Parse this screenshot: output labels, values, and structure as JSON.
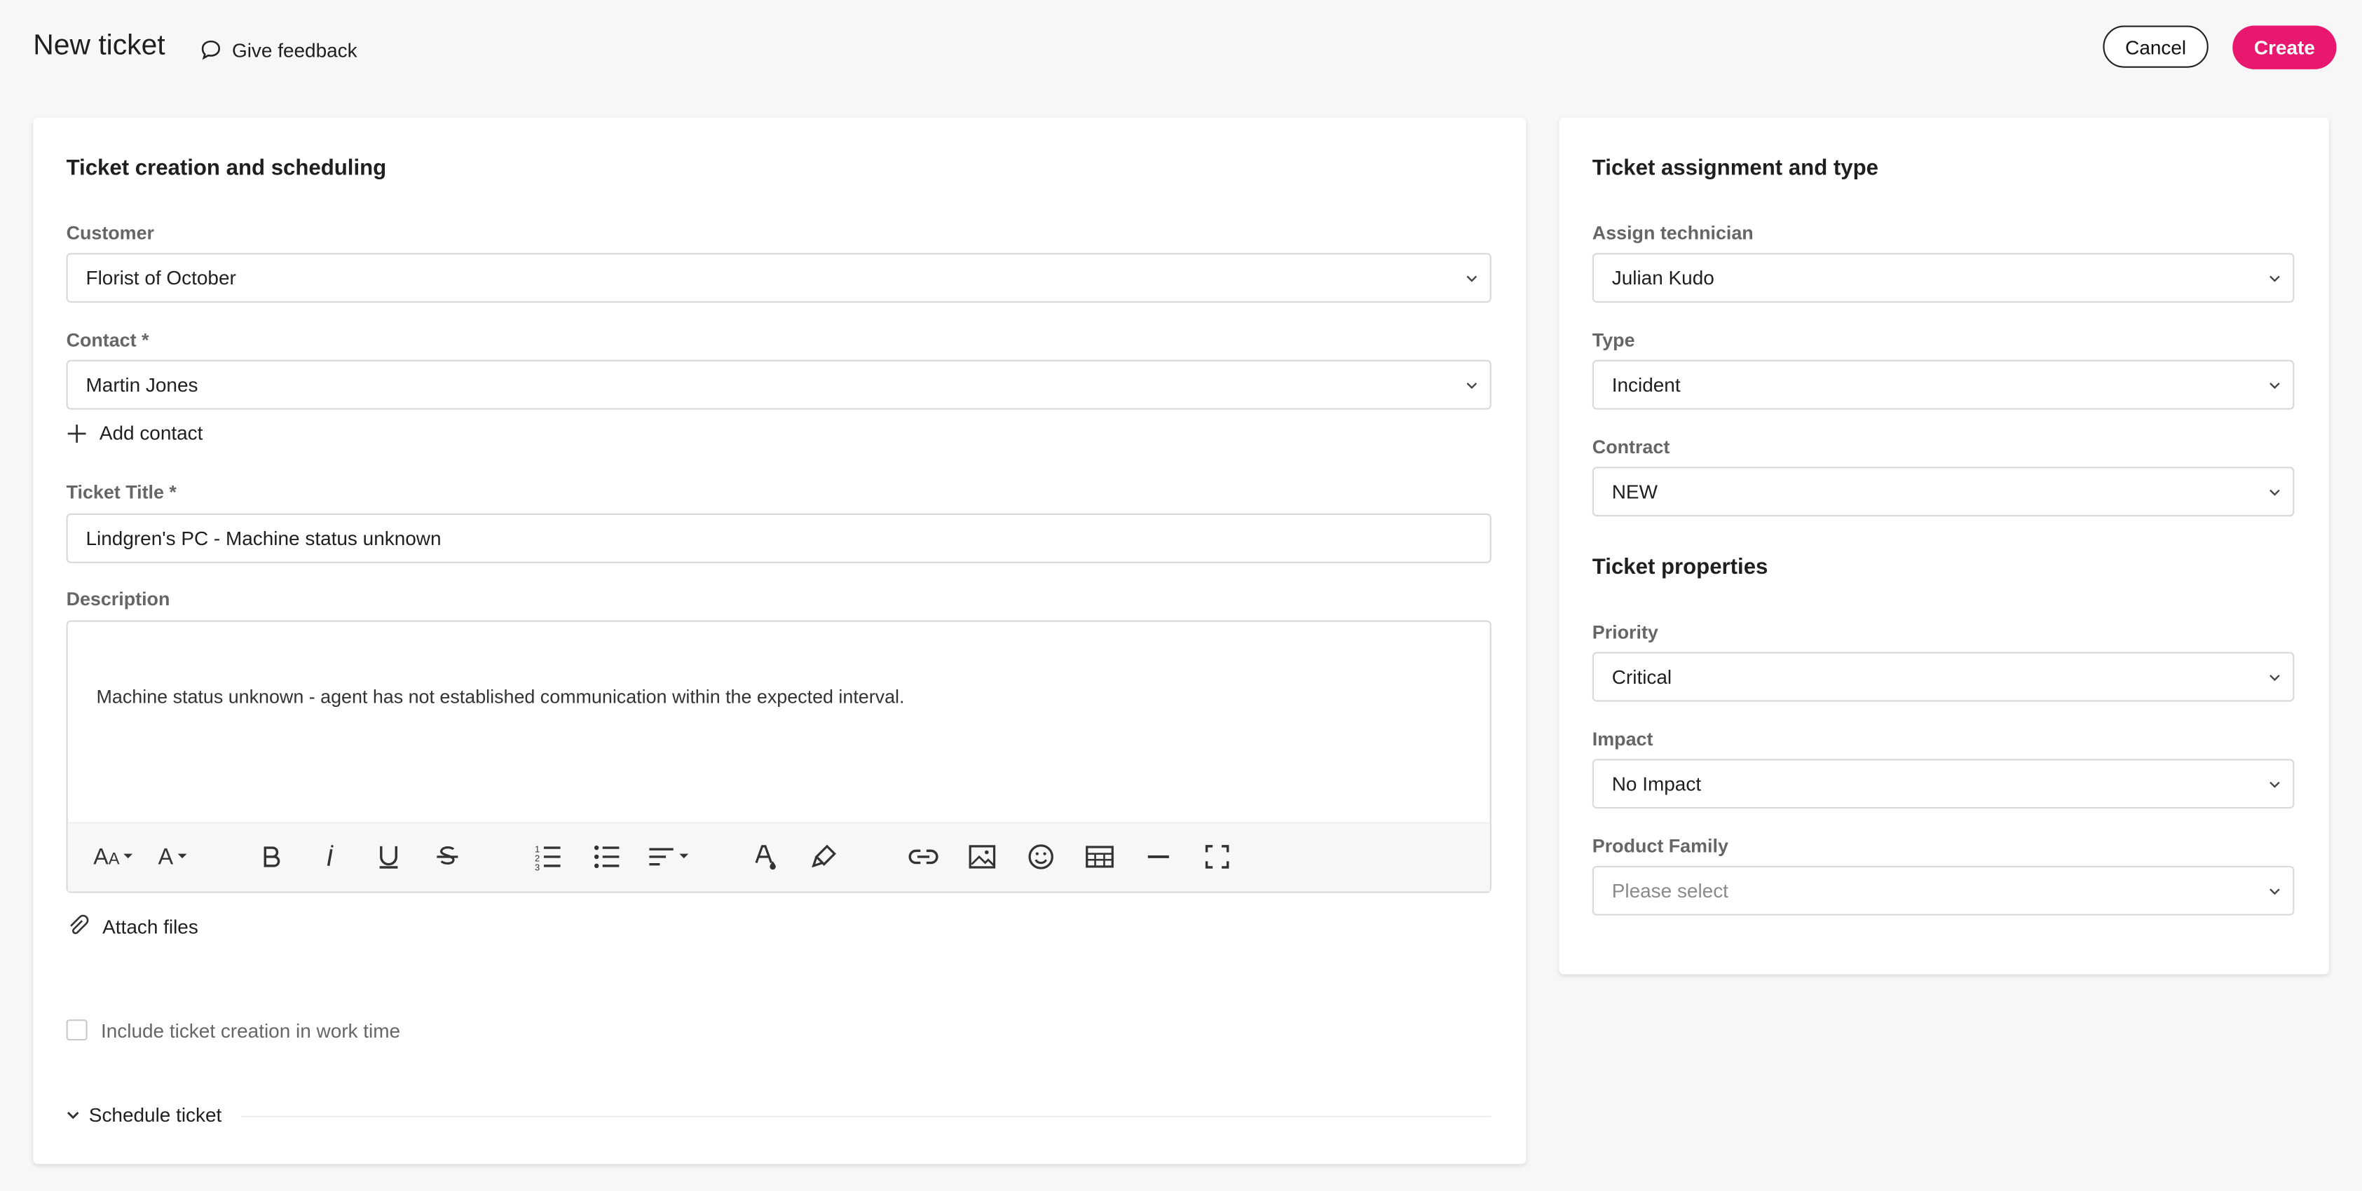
{
  "header": {
    "title": "New ticket",
    "feedback_label": "Give feedback",
    "cancel_label": "Cancel",
    "create_label": "Create"
  },
  "left_card": {
    "title": "Ticket creation and scheduling",
    "customer": {
      "label": "Customer",
      "value": "Florist of October"
    },
    "contact": {
      "label": "Contact *",
      "value": "Martin Jones"
    },
    "add_contact_label": "Add contact",
    "ticket_title": {
      "label": "Ticket Title *",
      "value": "Lindgren's PC - Machine status unknown"
    },
    "description": {
      "label": "Description",
      "text": "Machine status unknown - agent has not established communication within the expected interval."
    },
    "attach_files_label": "Attach files",
    "include_work_time_label": "Include ticket creation in work time",
    "schedule_label": "Schedule ticket"
  },
  "right_card": {
    "title": "Ticket assignment and type",
    "technician": {
      "label": "Assign technician",
      "value": "Julian Kudo"
    },
    "type": {
      "label": "Type",
      "value": "Incident"
    },
    "contract": {
      "label": "Contract",
      "value": "NEW"
    },
    "properties_title": "Ticket properties",
    "priority": {
      "label": "Priority",
      "value": "Critical"
    },
    "impact": {
      "label": "Impact",
      "value": "No Impact"
    },
    "product_family": {
      "label": "Product Family",
      "placeholder": "Please select"
    }
  },
  "colors": {
    "accent": "#e8186e",
    "background": "#f7f7f7"
  },
  "toolbar_icons": [
    "font-size-icon",
    "font-family-icon",
    "bold-icon",
    "italic-icon",
    "underline-icon",
    "strikethrough-icon",
    "ordered-list-icon",
    "unordered-list-icon",
    "align-icon",
    "text-color-icon",
    "highlight-icon",
    "link-icon",
    "image-icon",
    "emoji-icon",
    "table-icon",
    "horizontal-rule-icon",
    "fullscreen-icon"
  ]
}
